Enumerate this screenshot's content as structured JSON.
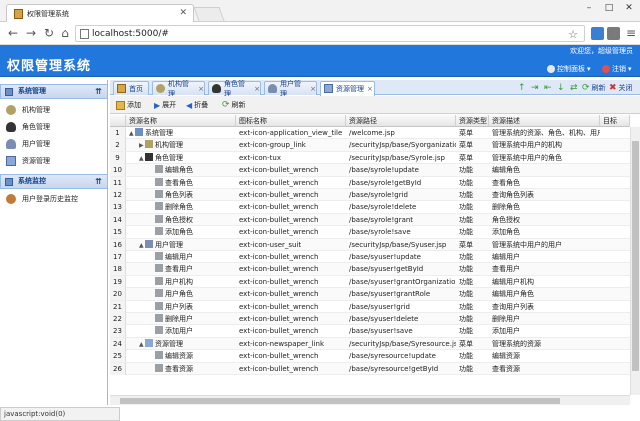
{
  "browser": {
    "tab_title": "权限管理系统",
    "url": "localhost:5000/#"
  },
  "header": {
    "title": "权限管理系统",
    "welcome": "欢迎您，超级管理员",
    "control_panel": "控制面板",
    "logout": "注销"
  },
  "sidebar": {
    "groups": [
      {
        "title": "系统管理",
        "items": [
          "机构管理",
          "角色管理",
          "用户管理",
          "资源管理"
        ]
      },
      {
        "title": "系统监控",
        "items": [
          "用户登录历史监控"
        ]
      }
    ]
  },
  "tabs": [
    {
      "label": "首页"
    },
    {
      "label": "机构管理"
    },
    {
      "label": "角色管理"
    },
    {
      "label": "用户管理"
    },
    {
      "label": "资源管理"
    }
  ],
  "tab_tools": {
    "refresh": "刷新",
    "close": "关闭"
  },
  "grid_toolbar": {
    "add": "添加",
    "expand": "展开",
    "collapse": "折叠",
    "refresh": "刷新"
  },
  "columns": [
    "资源名称",
    "图标名称",
    "资源路径",
    "资源类型",
    "资源描述",
    "目标"
  ],
  "rows": [
    {
      "no": "1",
      "name": "系统管理",
      "icon": "ext-icon-application_view_tile",
      "path": "/welcome.jsp",
      "type": "菜单",
      "desc": "管理系统的资源、角色、机构、用户等",
      "level": 0,
      "arrow": "▲"
    },
    {
      "no": "2",
      "name": "机构管理",
      "icon": "ext-icon-group_link",
      "path": "/securityJsp/base/Syorganization.jsp",
      "type": "菜单",
      "desc": "管理系统中用户的机构",
      "level": 1,
      "arrow": "▶"
    },
    {
      "no": "9",
      "name": "角色管理",
      "icon": "ext-icon-tux",
      "path": "/securityJsp/base/Syrole.jsp",
      "type": "菜单",
      "desc": "管理系统中用户的角色",
      "level": 1,
      "arrow": "▲"
    },
    {
      "no": "10",
      "name": "编辑角色",
      "icon": "ext-icon-bullet_wrench",
      "path": "/base/syrole!update",
      "type": "功能",
      "desc": "编辑角色",
      "level": 2,
      "arrow": ""
    },
    {
      "no": "11",
      "name": "查看角色",
      "icon": "ext-icon-bullet_wrench",
      "path": "/base/syrole!getById",
      "type": "功能",
      "desc": "查看角色",
      "level": 2,
      "arrow": ""
    },
    {
      "no": "12",
      "name": "角色列表",
      "icon": "ext-icon-bullet_wrench",
      "path": "/base/syrole!grid",
      "type": "功能",
      "desc": "查询角色列表",
      "level": 2,
      "arrow": ""
    },
    {
      "no": "13",
      "name": "删除角色",
      "icon": "ext-icon-bullet_wrench",
      "path": "/base/syrole!delete",
      "type": "功能",
      "desc": "删除角色",
      "level": 2,
      "arrow": ""
    },
    {
      "no": "14",
      "name": "角色授权",
      "icon": "ext-icon-bullet_wrench",
      "path": "/base/syrole!grant",
      "type": "功能",
      "desc": "角色授权",
      "level": 2,
      "arrow": ""
    },
    {
      "no": "15",
      "name": "添加角色",
      "icon": "ext-icon-bullet_wrench",
      "path": "/base/syrole!save",
      "type": "功能",
      "desc": "添加角色",
      "level": 2,
      "arrow": ""
    },
    {
      "no": "16",
      "name": "用户管理",
      "icon": "ext-icon-user_suit",
      "path": "/securityJsp/base/Syuser.jsp",
      "type": "菜单",
      "desc": "管理系统中用户的用户",
      "level": 1,
      "arrow": "▲"
    },
    {
      "no": "17",
      "name": "编辑用户",
      "icon": "ext-icon-bullet_wrench",
      "path": "/base/syuser!update",
      "type": "功能",
      "desc": "编辑用户",
      "level": 2,
      "arrow": ""
    },
    {
      "no": "18",
      "name": "查看用户",
      "icon": "ext-icon-bullet_wrench",
      "path": "/base/syuser!getById",
      "type": "功能",
      "desc": "查看用户",
      "level": 2,
      "arrow": ""
    },
    {
      "no": "19",
      "name": "用户机构",
      "icon": "ext-icon-bullet_wrench",
      "path": "/base/syuser!grantOrganization",
      "type": "功能",
      "desc": "编辑用户机构",
      "level": 2,
      "arrow": ""
    },
    {
      "no": "20",
      "name": "用户角色",
      "icon": "ext-icon-bullet_wrench",
      "path": "/base/syuser!grantRole",
      "type": "功能",
      "desc": "编辑用户角色",
      "level": 2,
      "arrow": ""
    },
    {
      "no": "21",
      "name": "用户列表",
      "icon": "ext-icon-bullet_wrench",
      "path": "/base/syuser!grid",
      "type": "功能",
      "desc": "查询用户列表",
      "level": 2,
      "arrow": ""
    },
    {
      "no": "22",
      "name": "删除用户",
      "icon": "ext-icon-bullet_wrench",
      "path": "/base/syuser!delete",
      "type": "功能",
      "desc": "删除用户",
      "level": 2,
      "arrow": ""
    },
    {
      "no": "23",
      "name": "添加用户",
      "icon": "ext-icon-bullet_wrench",
      "path": "/base/syuser!save",
      "type": "功能",
      "desc": "添加用户",
      "level": 2,
      "arrow": ""
    },
    {
      "no": "24",
      "name": "资源管理",
      "icon": "ext-icon-newspaper_link",
      "path": "/securityJsp/base/Syresource.jsp",
      "type": "菜单",
      "desc": "管理系统的资源",
      "level": 1,
      "arrow": "▲"
    },
    {
      "no": "25",
      "name": "编辑资源",
      "icon": "ext-icon-bullet_wrench",
      "path": "/base/syresource!update",
      "type": "功能",
      "desc": "编辑资源",
      "level": 2,
      "arrow": ""
    },
    {
      "no": "26",
      "name": "查看资源",
      "icon": "ext-icon-bullet_wrench",
      "path": "/base/syresource!getById",
      "type": "功能",
      "desc": "查看资源",
      "level": 2,
      "arrow": ""
    }
  ],
  "status": "javascript:void(0)"
}
